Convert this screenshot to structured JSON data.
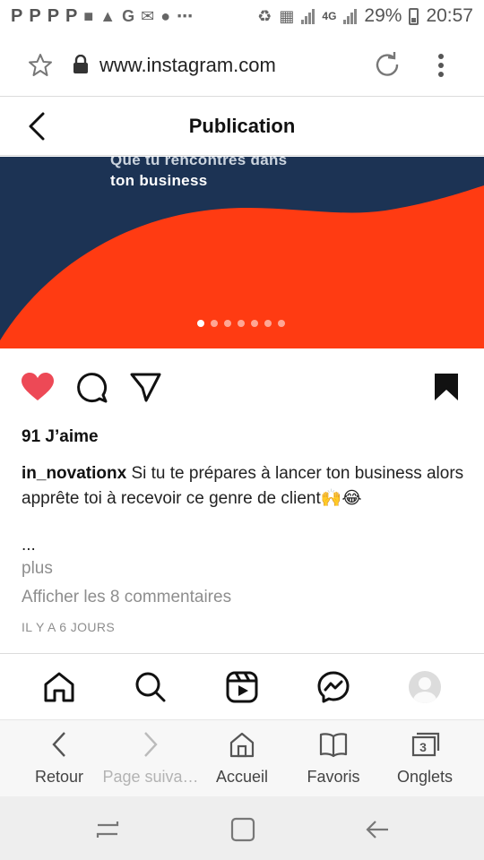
{
  "status_bar": {
    "notification_letters": [
      "P",
      "P",
      "P",
      "P"
    ],
    "notif_icons": [
      "chat-icon",
      "warning-icon",
      "g-icon",
      "gmail-icon",
      "s-icon",
      "more-dots-icon"
    ],
    "network_label": "4G",
    "battery": "29%",
    "time": "20:57"
  },
  "url_bar": {
    "url": "www.instagram.com"
  },
  "header": {
    "title": "Publication"
  },
  "post": {
    "image_text_1": "Que tu rencontres dans",
    "image_text_2": "ton business",
    "carousel_count": 7,
    "carousel_active": 0,
    "likes": "91 J’aime",
    "username": "in_novationx",
    "caption": " Si tu te prépares à lancer ton business alors apprête toi à recevoir ce genre de client🙌😂",
    "ellipsis": "...",
    "more": "plus",
    "view_comments": "Afficher les 8 commentaires",
    "time_ago": "IL Y A 6 JOURS",
    "colors": {
      "navy": "#1c3354",
      "orange": "#ff3b12",
      "like_red": "#ed4956"
    }
  },
  "browser_toolbar": {
    "back": "Retour",
    "forward": "Page suiva…",
    "home": "Accueil",
    "bookmarks": "Favoris",
    "tabs": "Onglets",
    "tabs_count": "3"
  }
}
